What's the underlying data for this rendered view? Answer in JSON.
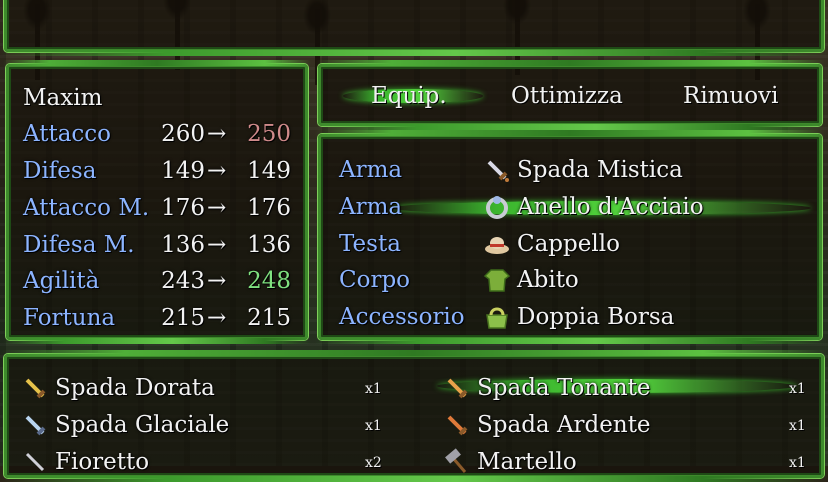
{
  "help_window": {
    "text": ""
  },
  "status": {
    "actor_name": "Maxim",
    "params": [
      {
        "label": "Attacco",
        "current": "260",
        "arrow": "→",
        "new": "250",
        "change": "down"
      },
      {
        "label": "Difesa",
        "current": "149",
        "arrow": "→",
        "new": "149",
        "change": "same"
      },
      {
        "label": "Attacco M.",
        "current": "176",
        "arrow": "→",
        "new": "176",
        "change": "same"
      },
      {
        "label": "Difesa M.",
        "current": "136",
        "arrow": "→",
        "new": "136",
        "change": "same"
      },
      {
        "label": "Agilità",
        "current": "243",
        "arrow": "→",
        "new": "248",
        "change": "up"
      },
      {
        "label": "Fortuna",
        "current": "215",
        "arrow": "→",
        "new": "215",
        "change": "same"
      }
    ]
  },
  "commands": {
    "equip": "Equip.",
    "optimize": "Ottimizza",
    "remove": "Rimuovi",
    "selected": "equip"
  },
  "slots": [
    {
      "slot": "Arma",
      "item": "Spada Mistica",
      "icon": "sword-icon"
    },
    {
      "slot": "Arma",
      "item": "Anello d'Acciaio",
      "icon": "ring-icon",
      "selected": true
    },
    {
      "slot": "Testa",
      "item": "Cappello",
      "icon": "hat-icon"
    },
    {
      "slot": "Corpo",
      "item": "Abito",
      "icon": "clothes-icon"
    },
    {
      "slot": "Accessorio",
      "item": "Doppia Borsa",
      "icon": "bag-icon"
    }
  ],
  "items": [
    {
      "name": "Spada Dorata",
      "qty": "x1",
      "icon": "sword-icon"
    },
    {
      "name": "Spada Tonante",
      "qty": "x1",
      "icon": "sword-icon",
      "selected": true
    },
    {
      "name": "Spada Glaciale",
      "qty": "x1",
      "icon": "sword-icon"
    },
    {
      "name": "Spada Ardente",
      "qty": "x1",
      "icon": "sword-icon"
    },
    {
      "name": "Fioretto",
      "qty": "x2",
      "icon": "sword-icon"
    },
    {
      "name": "Martello",
      "qty": "x1",
      "icon": "hammer-icon"
    }
  ],
  "colors": {
    "system_blue": "#8cb4ff",
    "power_up": "#7fe07f",
    "power_down": "#d08a8a",
    "frame_green": "#3e8a2c"
  }
}
